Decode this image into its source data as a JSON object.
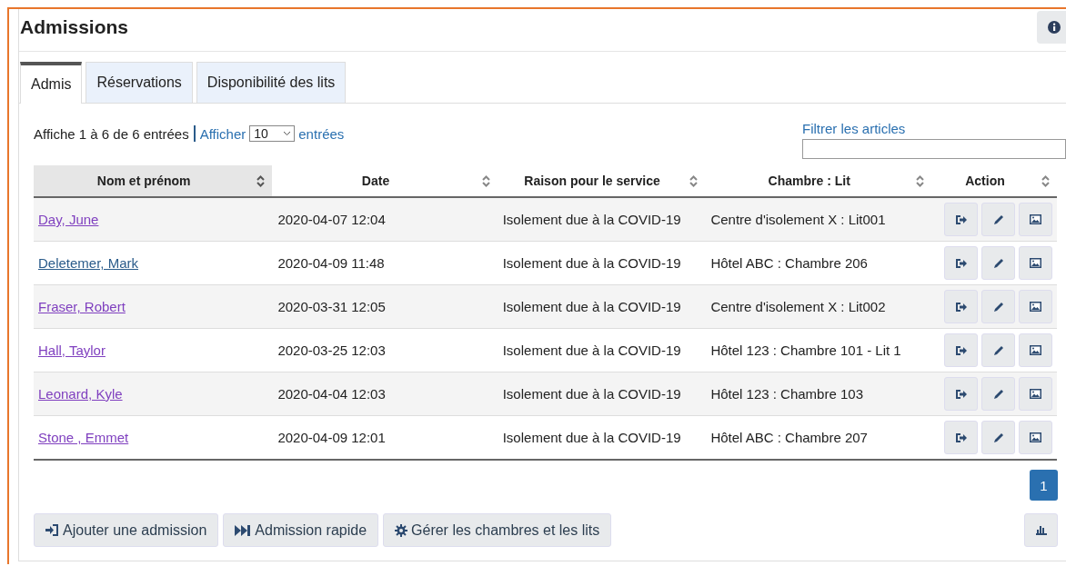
{
  "page": {
    "title": "Admissions"
  },
  "tabs": [
    {
      "label": "Admis",
      "selected": true
    },
    {
      "label": "Réservations",
      "selected": false
    },
    {
      "label": "Disponibilité des lits",
      "selected": false
    }
  ],
  "info": {
    "text": "Affiche 1 à 6 de 6 entrées",
    "show_label": "Afficher",
    "page_size": "10",
    "entries_label": "entrées"
  },
  "filter": {
    "label": "Filtrer les articles"
  },
  "table": {
    "columns": [
      {
        "label": "Nom et prénom",
        "sorted": true
      },
      {
        "label": "Date",
        "sorted": false
      },
      {
        "label": "Raison pour le service",
        "sorted": false
      },
      {
        "label": "Chambre : Lit",
        "sorted": false
      },
      {
        "label": "Action",
        "sorted": false
      }
    ],
    "rows": [
      {
        "name": "Day, June",
        "visited": true,
        "date": "2020-04-07 12:04",
        "reason": "Isolement due à la COVID-19",
        "room": "Centre d'isolement X : Lit001"
      },
      {
        "name": "Deletemer, Mark",
        "visited": false,
        "date": "2020-04-09 11:48",
        "reason": "Isolement due à la COVID-19",
        "room": "Hôtel ABC : Chambre 206"
      },
      {
        "name": "Fraser, Robert",
        "visited": true,
        "date": "2020-03-31 12:05",
        "reason": "Isolement due à la COVID-19",
        "room": "Centre d'isolement X : Lit002"
      },
      {
        "name": "Hall, Taylor",
        "visited": true,
        "date": "2020-03-25 12:03",
        "reason": "Isolement due à la COVID-19",
        "room": "Hôtel 123 : Chambre 101 - Lit 1"
      },
      {
        "name": "Leonard, Kyle",
        "visited": true,
        "date": "2020-04-04 12:03",
        "reason": "Isolement due à la COVID-19",
        "room": "Hôtel 123 : Chambre 103"
      },
      {
        "name": "Stone , Emmet",
        "visited": true,
        "date": "2020-04-09 12:01",
        "reason": "Isolement due à la COVID-19",
        "room": "Hôtel ABC : Chambre 207"
      }
    ]
  },
  "pagination": [
    {
      "label": "1",
      "selected": true
    }
  ],
  "buttons": [
    {
      "kind": "add",
      "label": "Ajouter une admission"
    },
    {
      "kind": "fast",
      "label": "Admission rapide"
    },
    {
      "kind": "manage",
      "label": "Gérer les chambres et les lits"
    }
  ]
}
